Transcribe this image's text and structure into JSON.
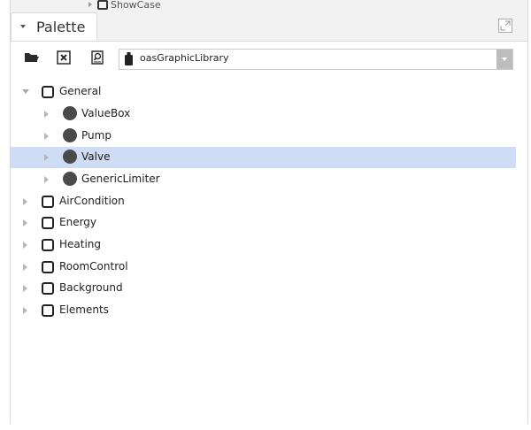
{
  "above_tree": {
    "partial_item": "ShowCase"
  },
  "palette": {
    "title": "Palette",
    "library": "oasGraphicLibrary",
    "toolbar": {
      "open": "folder-open-icon",
      "close": "close-box-icon",
      "find": "find-icon"
    },
    "tree": {
      "expanded_folder": "General",
      "children": [
        {
          "label": "ValueBox",
          "selected": false
        },
        {
          "label": "Pump",
          "selected": false
        },
        {
          "label": "Valve",
          "selected": true
        },
        {
          "label": "GenericLimiter",
          "selected": false
        }
      ],
      "folders": [
        "AirCondition",
        "Energy",
        "Heating",
        "RoomControl",
        "Background",
        "Elements"
      ]
    }
  },
  "colors": {
    "selection": "#cfdcf5",
    "tree_icon": "#222222",
    "component_ball": "#4a4a4a"
  }
}
